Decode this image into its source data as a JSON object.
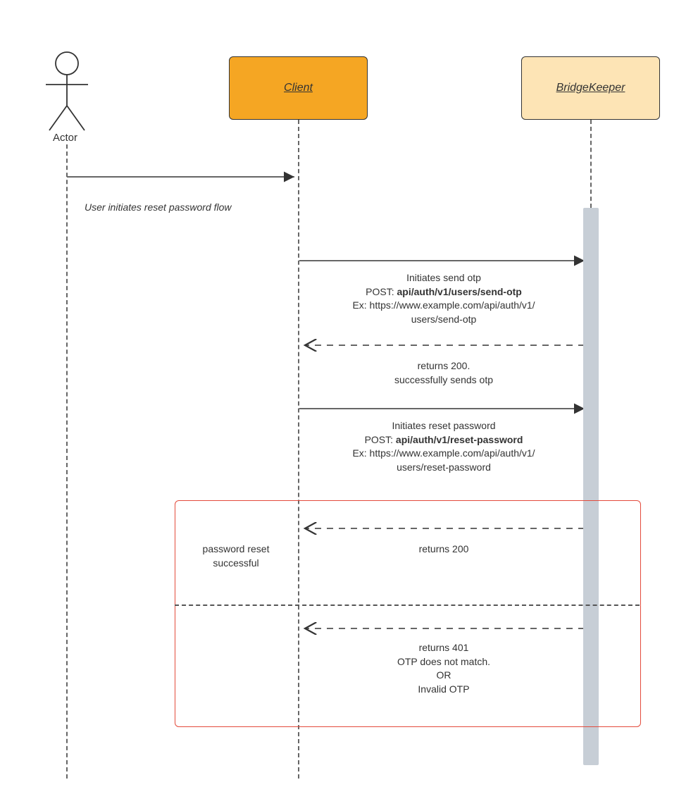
{
  "actor": {
    "label": "Actor"
  },
  "participants": {
    "client": {
      "label": "Client"
    },
    "bridgekeeper": {
      "label": "BridgeKeeper"
    }
  },
  "messages": {
    "m1": {
      "text": "User initiates reset password flow"
    },
    "m2": {
      "line1": "Initiates send otp",
      "line2a": "POST: ",
      "line2b": "api/auth/v1/users/send-otp",
      "line3": "Ex: https://www.example.com/api/auth/v1/",
      "line4": "users/send-otp"
    },
    "m3": {
      "line1": "returns 200.",
      "line2": "successfully sends otp"
    },
    "m4": {
      "line1": "Initiates reset password",
      "line2a": "POST: ",
      "line2b": "api/auth/v1/reset-password",
      "line3": "Ex: https://www.example.com/api/auth/v1/",
      "line4": "users/reset-password"
    },
    "m5": {
      "text": "returns 200"
    },
    "m5guard": {
      "line1": "password reset",
      "line2": "successful"
    },
    "m6": {
      "line1": "returns 401",
      "line2": "OTP does not match.",
      "line3": "OR",
      "line4": "Invalid OTP"
    }
  }
}
